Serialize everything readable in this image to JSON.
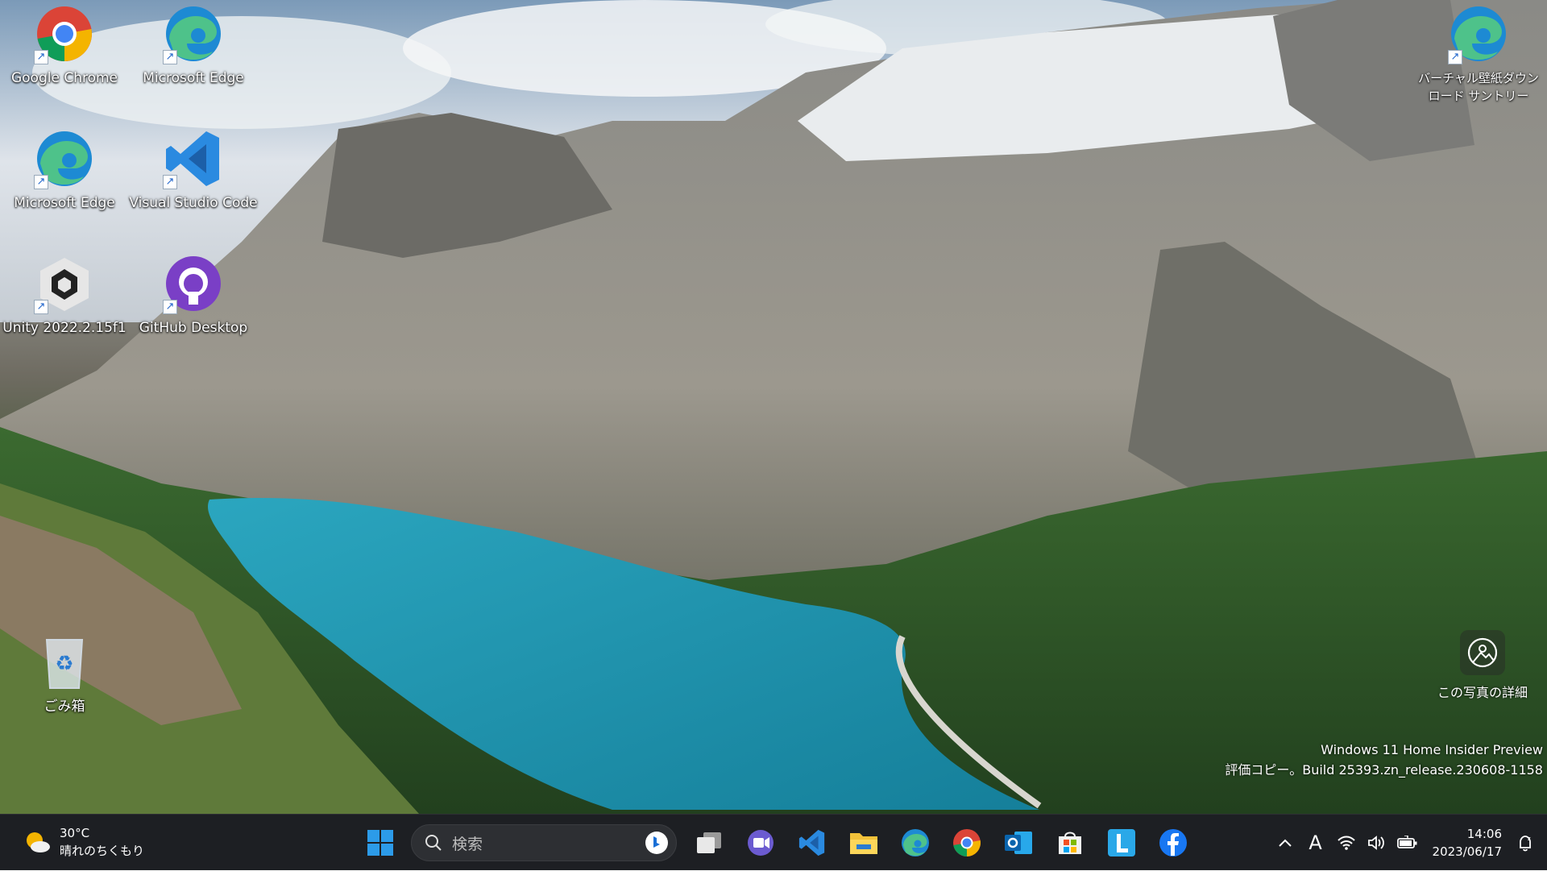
{
  "desktop": {
    "icons": [
      {
        "label": "Google Chrome",
        "icon": "chrome-icon"
      },
      {
        "label": "Microsoft Edge",
        "icon": "edge-icon"
      },
      {
        "label": "Microsoft Edge",
        "icon": "edge-icon"
      },
      {
        "label": "Visual Studio Code",
        "icon": "vscode-icon"
      },
      {
        "label": "Unity 2022.2.15f1",
        "icon": "unity-icon"
      },
      {
        "label": "GitHub Desktop",
        "icon": "github-icon"
      },
      {
        "label": "バーチャル壁紙ダウンロード サントリー",
        "icon": "edge-icon"
      },
      {
        "label": "ごみ箱",
        "icon": "recycle-bin-icon"
      }
    ],
    "photo_info_label": "この写真の詳細",
    "watermark": {
      "line1": "Windows 11 Home Insider Preview",
      "line2": "評価コピー。Build 25393.zn_release.230608-1158"
    }
  },
  "taskbar": {
    "weather": {
      "temp": "30°C",
      "condition": "晴れのちくもり"
    },
    "search_placeholder": "検索",
    "apps": [
      "start-icon",
      "task-view-icon",
      "teams-chat-icon",
      "vscode-icon",
      "file-explorer-icon",
      "edge-icon",
      "chrome-icon",
      "outlook-icon",
      "microsoft-store-icon",
      "l-app-icon",
      "facebook-icon"
    ],
    "tray": {
      "ime": "A",
      "time": "14:06",
      "date": "2023/06/17"
    }
  },
  "colors": {
    "taskbar_bg": "#1d1f23",
    "lake": "#1d9bb5",
    "vscode_blue": "#2a8ae0",
    "facebook_blue": "#1877f2"
  }
}
